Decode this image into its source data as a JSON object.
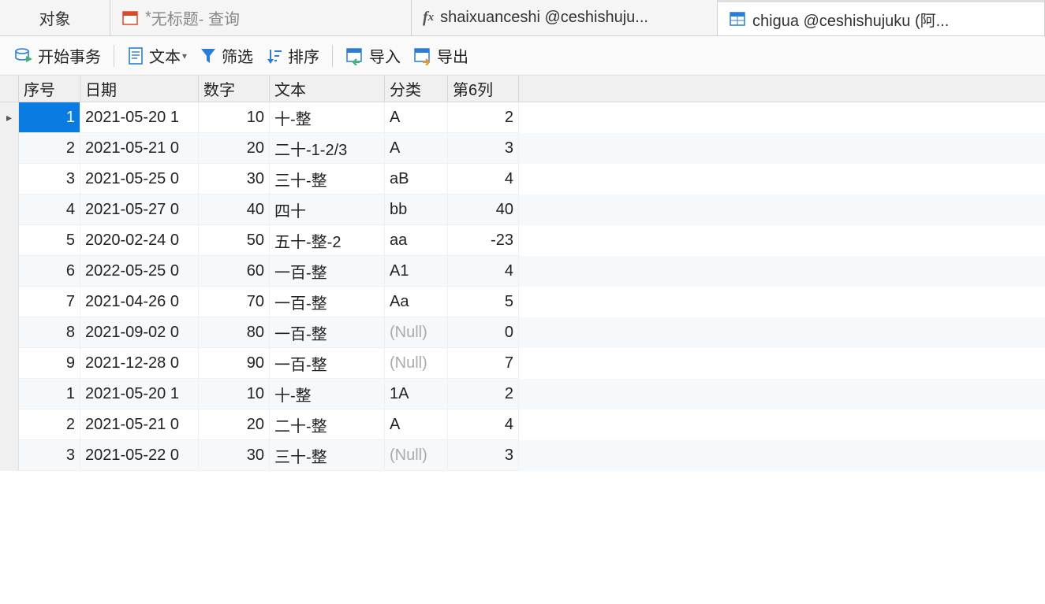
{
  "tabs": {
    "object": "对象",
    "query_prefix": "* ",
    "query_title": "无标题",
    "query_suffix": " - 查询",
    "function_label": "shaixuanceshi @ceshishuju...",
    "table_label": "chigua @ceshishujuku (阿..."
  },
  "toolbar": {
    "begin_tx": "开始事务",
    "text_btn": "文本",
    "filter": "筛选",
    "sort": "排序",
    "import": "导入",
    "export": "导出"
  },
  "columns": {
    "seq": "序号",
    "date": "日期",
    "num": "数字",
    "text": "文本",
    "cat": "分类",
    "c6": "第6列"
  },
  "null_label": "(Null)",
  "rows": [
    {
      "seq": "1",
      "date": "2021-05-20 1",
      "num": "10",
      "text": "十-整",
      "cat": "A",
      "c6": "2",
      "current": true
    },
    {
      "seq": "2",
      "date": "2021-05-21 0",
      "num": "20",
      "text": "二十-1-2/3",
      "cat": "A",
      "c6": "3"
    },
    {
      "seq": "3",
      "date": "2021-05-25 0",
      "num": "30",
      "text": "三十-整",
      "cat": "aB",
      "c6": "4"
    },
    {
      "seq": "4",
      "date": "2021-05-27 0",
      "num": "40",
      "text": "四十",
      "cat": "bb",
      "c6": "40"
    },
    {
      "seq": "5",
      "date": "2020-02-24 0",
      "num": "50",
      "text": "五十-整-2",
      "cat": "aa",
      "c6": "-23"
    },
    {
      "seq": "6",
      "date": "2022-05-25 0",
      "num": "60",
      "text": "一百-整",
      "cat": "A1",
      "c6": "4"
    },
    {
      "seq": "7",
      "date": "2021-04-26 0",
      "num": "70",
      "text": "一百-整",
      "cat": "Aa",
      "c6": "5"
    },
    {
      "seq": "8",
      "date": "2021-09-02 0",
      "num": "80",
      "text": "一百-整",
      "cat": null,
      "c6": "0"
    },
    {
      "seq": "9",
      "date": "2021-12-28 0",
      "num": "90",
      "text": "一百-整",
      "cat": null,
      "c6": "7"
    },
    {
      "seq": "1",
      "date": "2021-05-20 1",
      "num": "10",
      "text": "十-整",
      "cat": "1A",
      "c6": "2"
    },
    {
      "seq": "2",
      "date": "2021-05-21 0",
      "num": "20",
      "text": "二十-整",
      "cat": "A",
      "c6": "4"
    },
    {
      "seq": "3",
      "date": "2021-05-22 0",
      "num": "30",
      "text": "三十-整",
      "cat": null,
      "c6": "3"
    }
  ]
}
